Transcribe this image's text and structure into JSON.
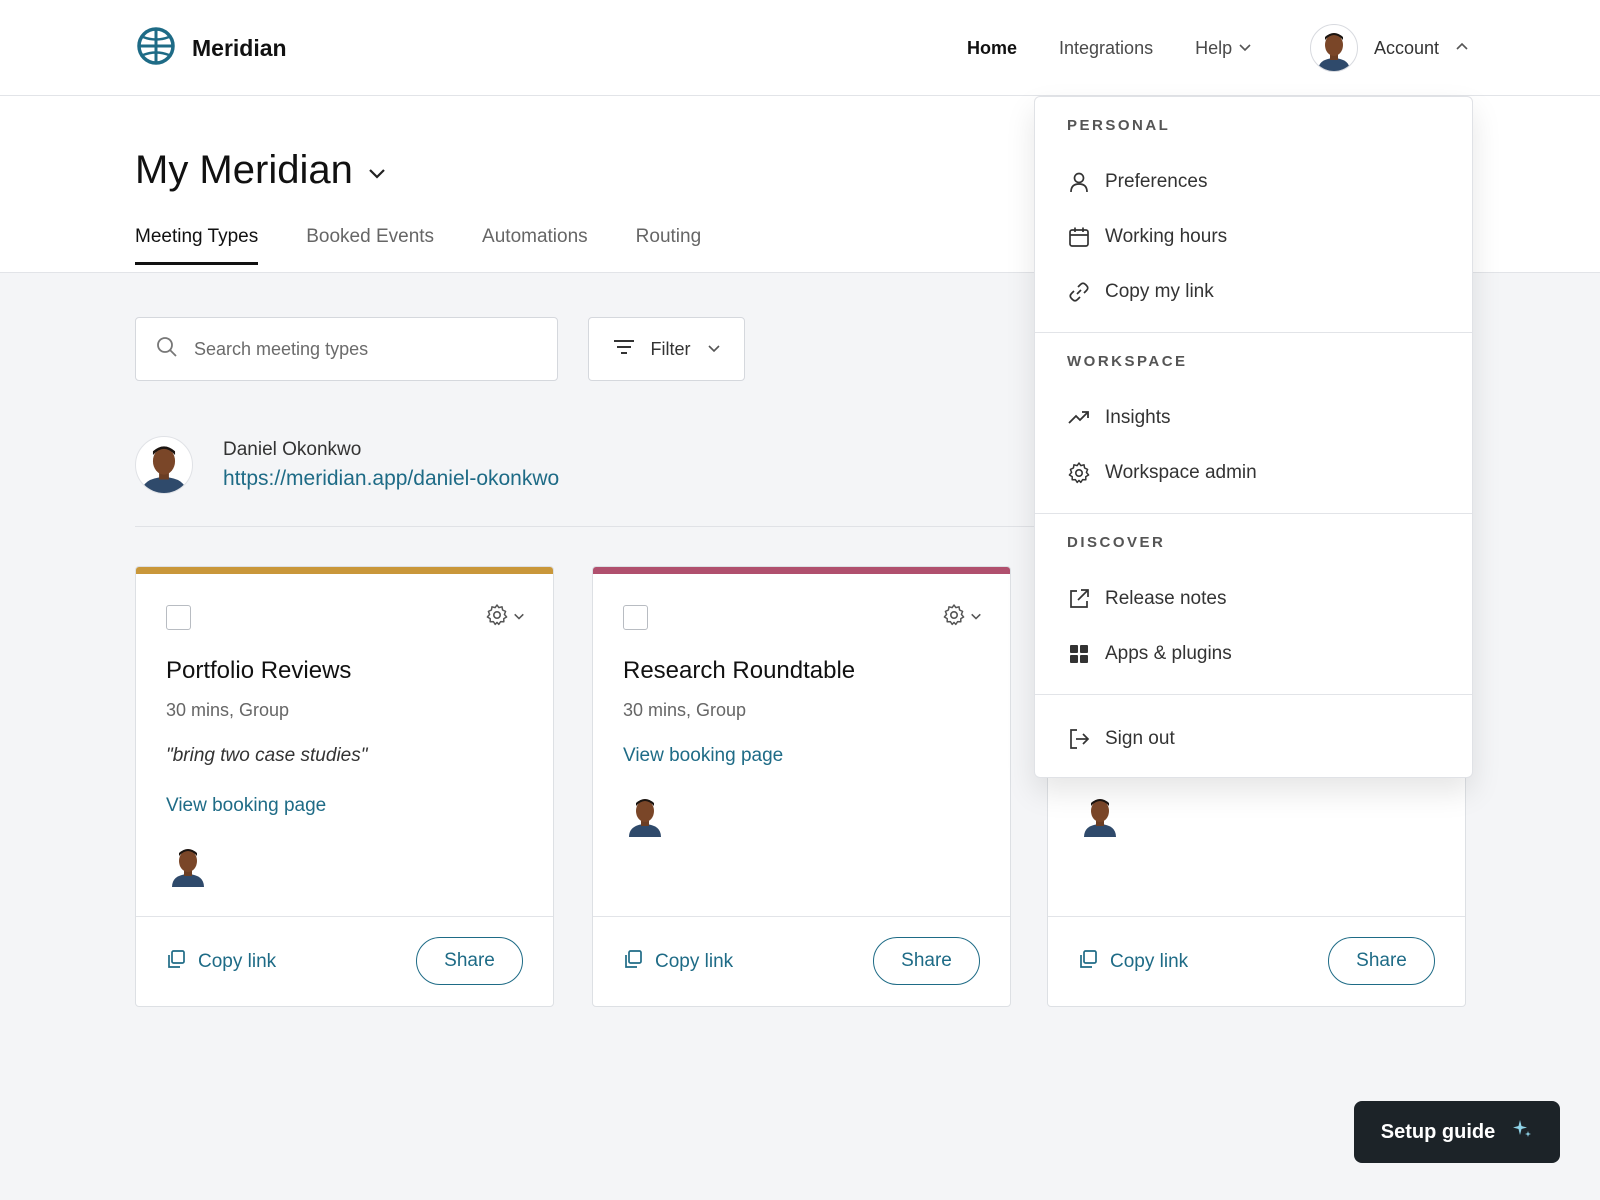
{
  "brand": {
    "name": "Meridian",
    "accent": "#1e6b86"
  },
  "nav": {
    "home": "Home",
    "integrations": "Integrations",
    "help": "Help",
    "account": "Account"
  },
  "header": {
    "title": "My Meridian",
    "tabs": [
      "Meeting Types",
      "Booked Events",
      "Automations",
      "Routing"
    ]
  },
  "search": {
    "placeholder": "Search meeting types"
  },
  "filter": {
    "label": "Filter"
  },
  "user": {
    "name": "Daniel Okonkwo",
    "link": "https://meridian.app/daniel-okonkwo"
  },
  "cards": [
    {
      "title": "Portfolio Reviews",
      "subtitle": "30 mins, Group",
      "note": "\"bring two case studies\"",
      "link": "View booking page",
      "copy": "Copy link",
      "share": "Share",
      "color": "#c9973a"
    },
    {
      "title": "Research Roundtable",
      "subtitle": "30 mins, Group",
      "link": "View booking page",
      "copy": "Copy link",
      "share": "Share",
      "color": "#b0506e"
    },
    {
      "copy": "Copy link",
      "share": "Share"
    }
  ],
  "dropdown": {
    "personal": {
      "heading": "PERSONAL",
      "items": [
        "Preferences",
        "Working hours",
        "Copy my link"
      ]
    },
    "workspace": {
      "heading": "WORKSPACE",
      "items": [
        "Insights",
        "Workspace admin"
      ]
    },
    "discover": {
      "heading": "DISCOVER",
      "items": [
        "Release notes",
        "Apps & plugins"
      ]
    },
    "signout": "Sign out"
  },
  "setup": {
    "label": "Setup guide"
  }
}
